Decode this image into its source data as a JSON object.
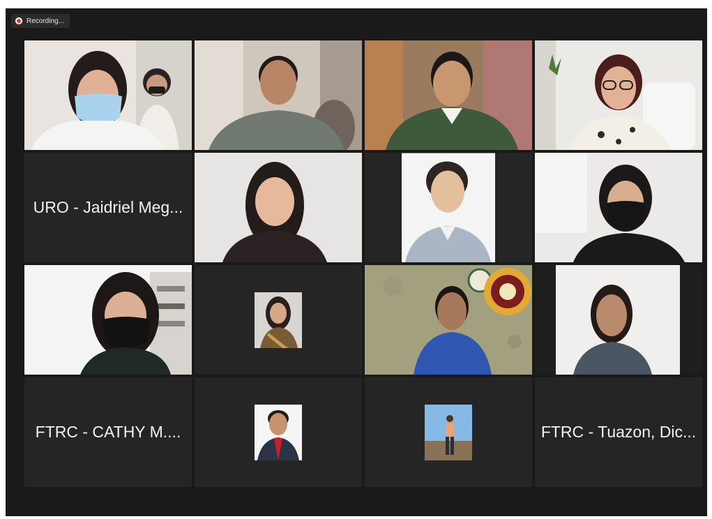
{
  "recording": {
    "label": "Recording...",
    "color": "#e0332e"
  },
  "active_speaker_border": "#e7ec8b",
  "participants": [
    {
      "kind": "video",
      "icon": "person-video-icon"
    },
    {
      "kind": "video",
      "icon": "person-video-icon"
    },
    {
      "kind": "video",
      "icon": "person-video-icon",
      "active": true
    },
    {
      "kind": "video",
      "icon": "person-video-icon"
    },
    {
      "kind": "name",
      "label": "URO - Jaidriel Meg..."
    },
    {
      "kind": "video",
      "icon": "person-video-icon"
    },
    {
      "kind": "photo",
      "icon": "profile-photo-icon"
    },
    {
      "kind": "video",
      "icon": "person-video-icon"
    },
    {
      "kind": "video",
      "icon": "person-video-icon"
    },
    {
      "kind": "photo",
      "icon": "profile-photo-icon"
    },
    {
      "kind": "video",
      "icon": "person-video-icon"
    },
    {
      "kind": "video",
      "icon": "person-video-icon"
    },
    {
      "kind": "name",
      "label": "FTRC - CATHY M...."
    },
    {
      "kind": "photo",
      "icon": "profile-photo-icon"
    },
    {
      "kind": "photo",
      "icon": "profile-photo-icon"
    },
    {
      "kind": "name",
      "label": "FTRC - Tuazon, Dic..."
    }
  ]
}
